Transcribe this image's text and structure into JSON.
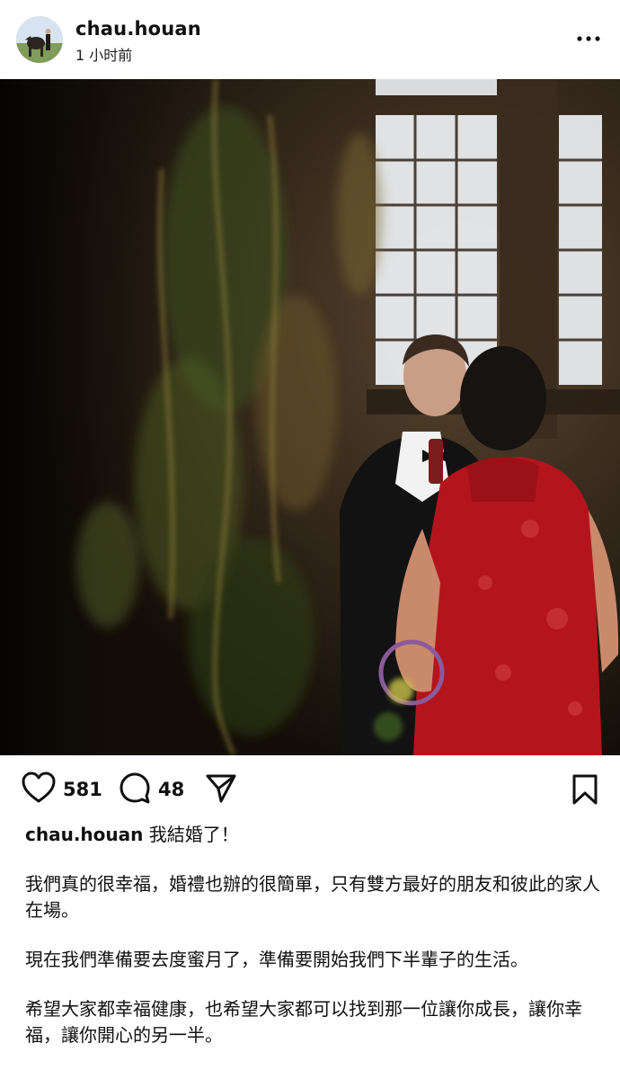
{
  "post": {
    "username": "chau.houan",
    "time_ago": "1 小时前",
    "likes": "581",
    "comments": "48"
  },
  "caption": {
    "username": "chau.houan",
    "headline": " 我結婚了！",
    "paragraphs": [
      "我們真的很幸福，婚禮也辦的很簡單，只有雙方最好的朋友和彼此的家人在場。",
      "現在我們準備要去度蜜月了，準備要開始我們下半輩子的生活。",
      "希望大家都幸福健康，也希望大家都可以找到那一位讓你成長，讓你幸福，讓你開心的另一半。"
    ]
  },
  "icons": {
    "more": "more-options-icon",
    "like": "heart-icon",
    "comment": "comment-bubble-icon",
    "share": "paper-plane-icon",
    "save": "bookmark-icon"
  },
  "colors": {
    "text": "#111111",
    "dress": "#b4151c",
    "background": "#ffffff"
  }
}
